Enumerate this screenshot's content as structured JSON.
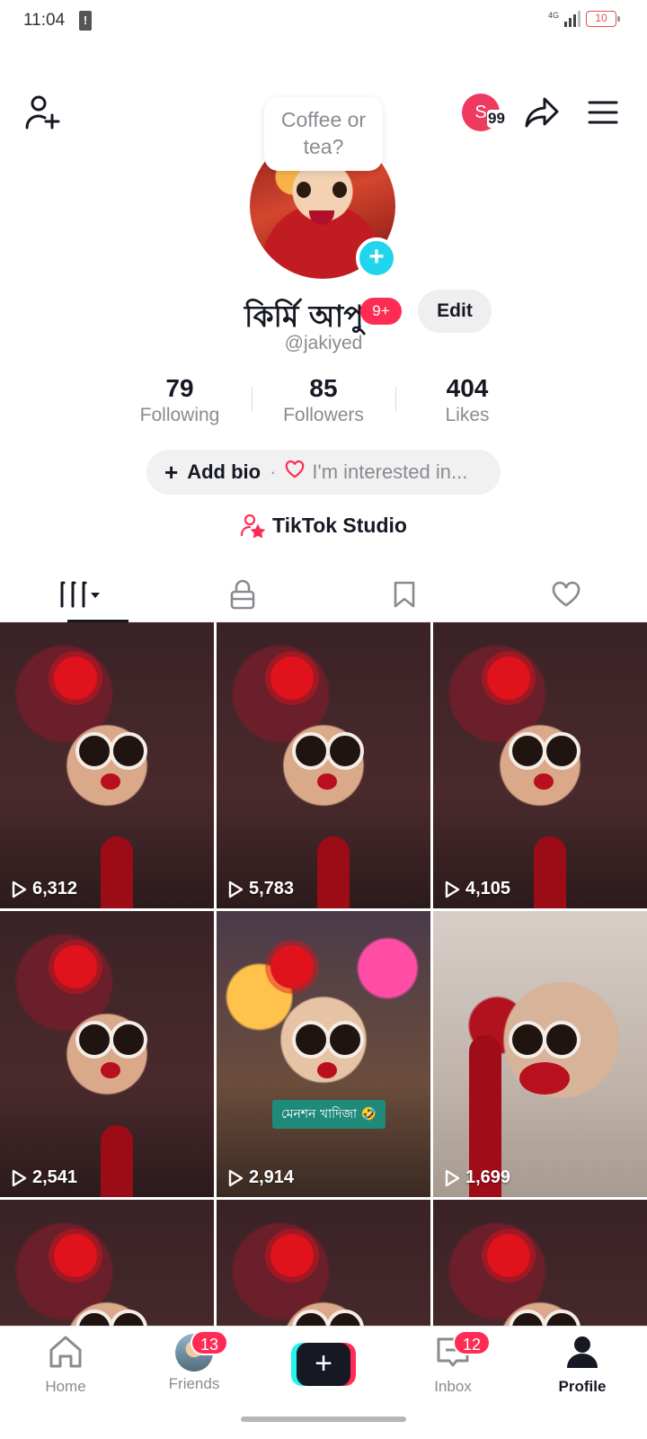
{
  "status_bar": {
    "time": "11:04",
    "alert_glyph": "!",
    "network": "4G",
    "battery": "10"
  },
  "header": {
    "speech_bubble": "Coffee or tea?",
    "mini_avatar_initial": "S",
    "mini_avatar_count": "99"
  },
  "profile": {
    "display_name": "কির্মি আপু",
    "name_badge": "9+",
    "edit_label": "Edit",
    "username": "@jakiyed"
  },
  "stats": [
    {
      "value": "79",
      "label": "Following"
    },
    {
      "value": "85",
      "label": "Followers"
    },
    {
      "value": "404",
      "label": "Likes"
    }
  ],
  "bio": {
    "add_label": "Add bio",
    "separator": "·",
    "interest_label": "I'm interested in..."
  },
  "studio": {
    "label": "TikTok Studio"
  },
  "tabs": [
    {
      "icon": "videos-grid-icon",
      "active": true
    },
    {
      "icon": "lock-icon",
      "active": false
    },
    {
      "icon": "bookmark-icon",
      "active": false
    },
    {
      "icon": "heart-icon",
      "active": false
    }
  ],
  "videos": [
    {
      "views": "6,312"
    },
    {
      "views": "5,783"
    },
    {
      "views": "4,105"
    },
    {
      "views": "2,541"
    },
    {
      "views": "2,914",
      "caption": "মেনশন খাদিজা 🤣"
    },
    {
      "views": "1,699"
    },
    {
      "views": ""
    },
    {
      "views": ""
    },
    {
      "views": ""
    }
  ],
  "bottom_nav": {
    "home": "Home",
    "friends": "Friends",
    "friends_badge": "13",
    "inbox": "Inbox",
    "inbox_badge": "12",
    "profile": "Profile",
    "create_symbol": "+"
  },
  "colors": {
    "accent": "#fe2c55",
    "cyan": "#25f4ee",
    "avatar_plus": "#20d5ec",
    "text": "#161823",
    "muted": "#8a8b91"
  }
}
